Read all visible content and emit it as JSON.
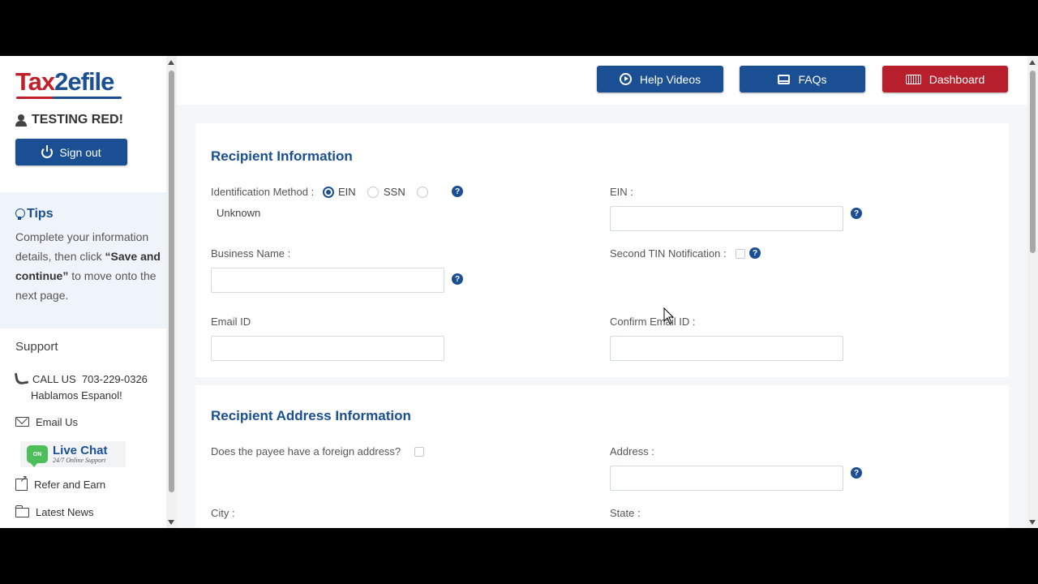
{
  "brand": {
    "logo_part1": "Tax",
    "logo_part2": "2",
    "logo_part3": "efile"
  },
  "user": {
    "name": "TESTING RED!"
  },
  "sidebar": {
    "signout_label": "Sign out",
    "tips": {
      "title": "Tips",
      "text_1": "Complete your information details, then click ",
      "text_bold": "“Save and continue”",
      "text_2": " to move onto the next page."
    },
    "support": {
      "title": "Support",
      "call_label": "CALL US",
      "phone": "703-229-0326",
      "spanish": "Hablamos Espanol!",
      "email_label": "Email Us",
      "livechat_badge": "ON",
      "livechat_title": "Live Chat",
      "livechat_sub": "24/7 Online Support",
      "refer_label": "Refer and Earn",
      "news_label": "Latest News"
    }
  },
  "topbar": {
    "help_videos": "Help Videos",
    "faqs": "FAQs",
    "dashboard": "Dashboard"
  },
  "recipient": {
    "title": "Recipient Information",
    "id_method_label": "Identification Method :",
    "opt_ein": "EIN",
    "opt_ssn": "SSN",
    "opt_unknown": "Unknown",
    "selected": "EIN",
    "ein_label": "EIN :",
    "ein_value": "",
    "business_name_label": "Business Name :",
    "business_name_value": "",
    "second_tin_label": "Second TIN Notification :",
    "email_label": "Email ID",
    "email_value": "",
    "confirm_email_label": "Confirm Email ID :",
    "confirm_email_value": ""
  },
  "address": {
    "title": "Recipient Address Information",
    "foreign_label": "Does the payee have a foreign address?",
    "address_label": "Address :",
    "address_value": "",
    "city_label": "City :",
    "state_label": "State :"
  },
  "colors": {
    "brand_blue": "#1b4f93",
    "brand_red": "#b71f2c"
  }
}
